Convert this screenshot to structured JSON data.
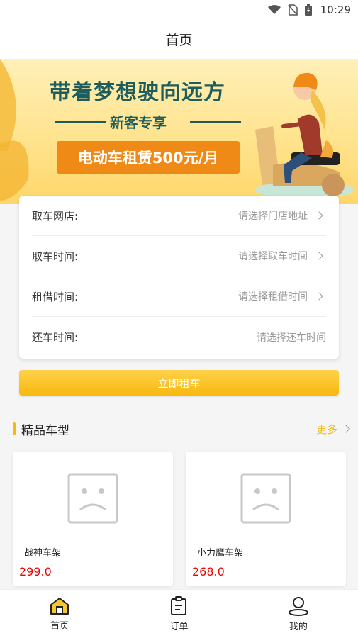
{
  "status_bar": {
    "time": "10:29"
  },
  "header": {
    "title": "首页"
  },
  "banner": {
    "headline": "带着梦想驶向远方",
    "subline": "新客专享",
    "promo": "电动车租赁500元/月"
  },
  "form": {
    "rows": [
      {
        "label": "取车网店:",
        "placeholder": "请选择门店地址",
        "chevron": true
      },
      {
        "label": "取车时间:",
        "placeholder": "请选择取车时间",
        "chevron": true
      },
      {
        "label": "租借时间:",
        "placeholder": "请选择租借时间",
        "chevron": true
      },
      {
        "label": "还车时间:",
        "placeholder": "请选择还车时间",
        "chevron": false
      }
    ]
  },
  "rent_button": {
    "label": "立即租车"
  },
  "section": {
    "title": "精品车型",
    "more": "更多"
  },
  "products": [
    {
      "name": "战神车架",
      "price": "299.0"
    },
    {
      "name": "小力鹰车架",
      "price": "268.0"
    }
  ],
  "bottom_nav": {
    "items": [
      {
        "label": "首页",
        "icon": "home-icon",
        "active": true
      },
      {
        "label": "订单",
        "icon": "clipboard-icon",
        "active": false
      },
      {
        "label": "我的",
        "icon": "user-icon",
        "active": false
      }
    ]
  },
  "colors": {
    "accent": "#f7b80f",
    "price": "#ee0000",
    "banner_text": "#1f5c5c",
    "promo_bg": "#f08a17"
  }
}
